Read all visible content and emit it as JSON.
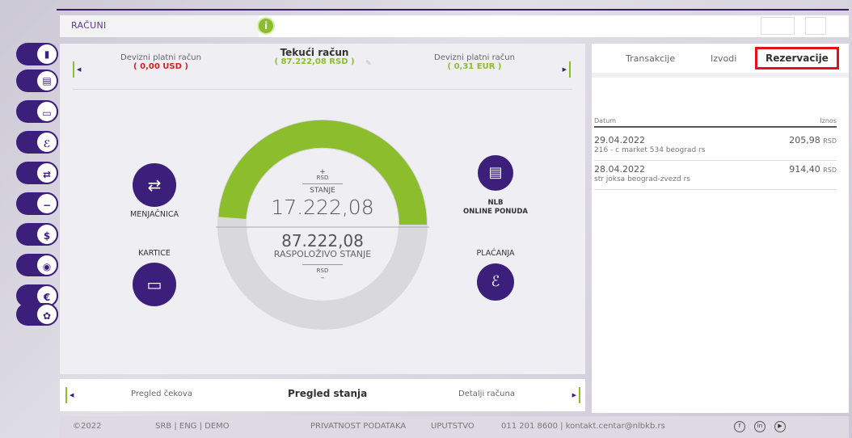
{
  "topbar": {
    "title": "RAČUNI",
    "info_icon": "i"
  },
  "sidebar": {
    "items": [
      {
        "icon": "chart-icon",
        "glyph": "▮"
      },
      {
        "icon": "documents-icon",
        "glyph": "▤"
      },
      {
        "icon": "card-icon",
        "glyph": "▭"
      },
      {
        "icon": "pen-signature-icon",
        "glyph": "ℰ"
      },
      {
        "icon": "exchange-documents-icon",
        "glyph": "⇄"
      },
      {
        "icon": "minus-card-icon",
        "glyph": "−"
      },
      {
        "icon": "dollar-icon",
        "glyph": "$"
      },
      {
        "icon": "location-icon",
        "glyph": "◉"
      },
      {
        "icon": "euro-icon",
        "glyph": "€"
      },
      {
        "icon": "settings-gear-icon",
        "glyph": "✿"
      }
    ]
  },
  "accounts": {
    "left": {
      "name": "Devizni platni račun",
      "amount": "( 0,00 USD )"
    },
    "center": {
      "name": "Tekući račun",
      "amount": "( 87.222,08 RSD )"
    },
    "right": {
      "name": "Devizni platni račun",
      "amount": "( 0,31 EUR )"
    }
  },
  "actions": {
    "exchange": "MENJAČNICA",
    "cards": "KARTICE",
    "offer_line1": "NLB",
    "offer_line2": "ONLINE PONUDA",
    "payments": "PLAĆANJA"
  },
  "gauge": {
    "plus": "+",
    "currency_top": "RSD",
    "balance_label": "STANJE",
    "balance": "17.222,08",
    "available": "87.222,08",
    "available_label": "RASPOLOŽIVO STANJE",
    "currency_bottom": "RSD",
    "minus": "–",
    "fill_fraction": 0.8
  },
  "right_panel": {
    "tabs": [
      "Transakcije",
      "Izvodi",
      "Rezervacije"
    ],
    "active_tab": "Rezervacije",
    "columns": {
      "date": "Datum",
      "amount": "Iznos"
    },
    "rows": [
      {
        "date": "29.04.2022",
        "desc": "216 - c market 534 beograd rs",
        "amount": "205,98",
        "cur": "RSD"
      },
      {
        "date": "28.04.2022",
        "desc": "str joksa beograd-zvezd rs",
        "amount": "914,40",
        "cur": "RSD"
      }
    ]
  },
  "bottom_nav": {
    "left": "Pregled čekova",
    "center": "Pregled stanja",
    "right": "Detalji računa"
  },
  "footer": {
    "copyright": "©2022",
    "languages": "SRB  |  ENG  |  DEMO",
    "privacy": "PRIVATNOST PODATAKA",
    "guide": "UPUTSTVO",
    "contact": "011 201 8600  |  kontakt.centar@nlbkb.rs",
    "social": [
      "f",
      "in",
      "▶"
    ]
  },
  "colors": {
    "brand_purple": "#3c1f7a",
    "accent_green": "#8bbd2d",
    "alert_red": "#d6201f",
    "highlight": "#e0131a"
  }
}
